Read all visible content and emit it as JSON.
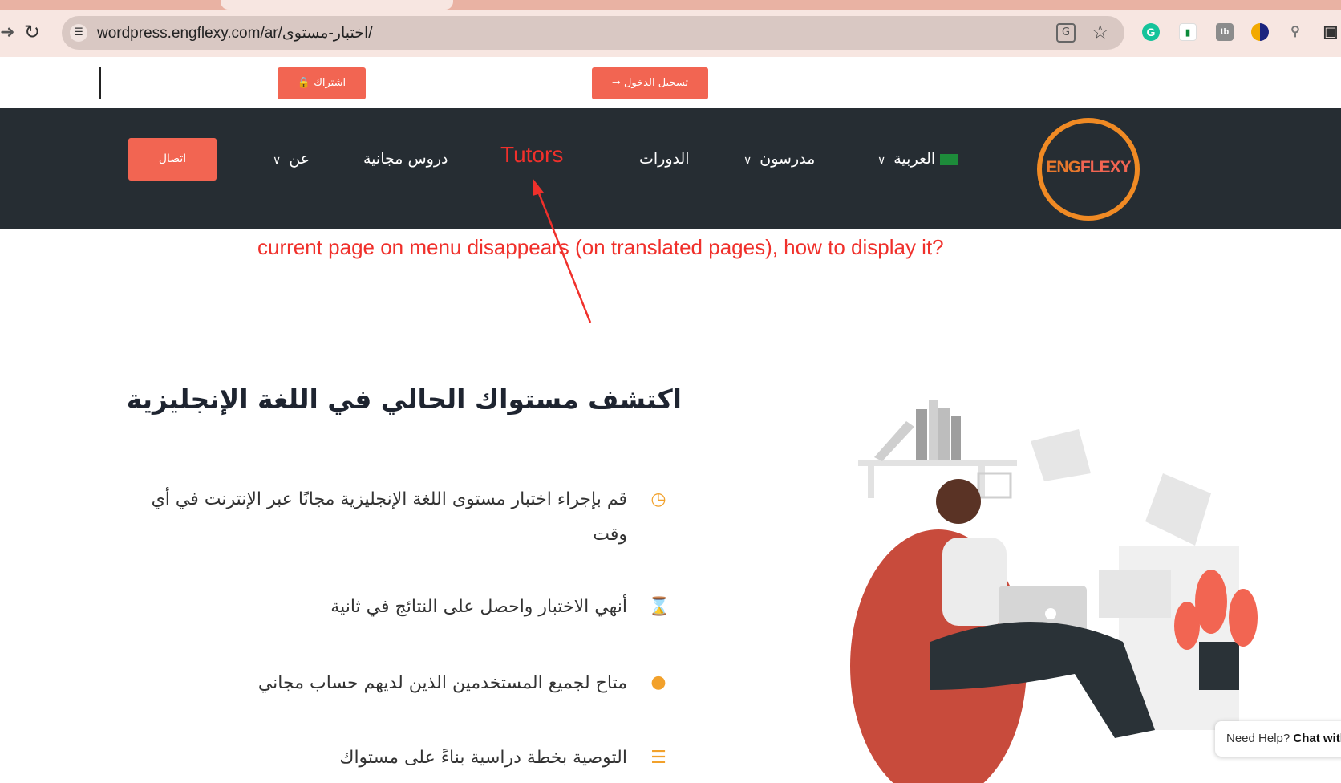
{
  "browser": {
    "url": "wordpress.engflexy.com/ar/اختبار-مستوى/",
    "icons": [
      "back-icon",
      "reload-icon",
      "site-info-icon",
      "translate-icon",
      "bookmark-star-icon",
      "grammarly-icon",
      "extension-icon",
      "tb-extension-icon",
      "extension-icon",
      "search-icon",
      "extensions-puzzle-icon"
    ],
    "ext_grammarly": "G",
    "ext_tb": "tb"
  },
  "topbar": {
    "subscribe_label": "اشتراك",
    "login_label": "تسجيل الدخول"
  },
  "nav": {
    "contact": "اتصال",
    "about": "عن",
    "free_lessons": "دروس مجانية",
    "tutors": "Tutors",
    "courses": "الدورات",
    "teachers": "مدرسون",
    "language": "العربية",
    "logo_text_a": "ENG",
    "logo_text_b": "FLEXY"
  },
  "annotation": "current page on menu disappears (on translated pages), how to display it?",
  "main": {
    "heading": "اكتشف مستواك الحالي في اللغة الإنجليزية",
    "features": [
      {
        "icon": "clock-icon",
        "text": "قم بإجراء اختبار مستوى اللغة الإنجليزية مجانًا عبر الإنترنت في أي وقت"
      },
      {
        "icon": "hourglass-icon",
        "text": "أنهي الاختبار واحصل على النتائج في ثانية"
      },
      {
        "icon": "user-icon",
        "text": "متاح لجميع المستخدمين الذين لديهم حساب مجاني"
      },
      {
        "icon": "layers-icon",
        "text": "التوصية بخطة دراسية بناءً على مستواك"
      }
    ]
  },
  "chat": {
    "prefix": "Need Help?",
    "bold": "Chat with"
  },
  "colors": {
    "accent": "#f26552",
    "nav_bg": "#262d33",
    "annotation": "#f0302b",
    "icon": "#f2a12b"
  }
}
